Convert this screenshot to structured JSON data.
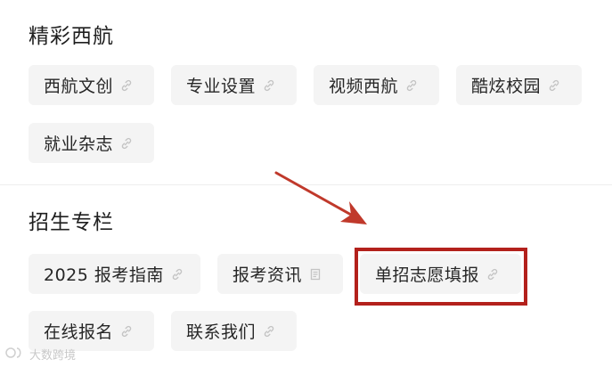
{
  "sections": [
    {
      "title": "精彩西航",
      "chips": [
        {
          "label": "西航文创",
          "icon": "link-icon"
        },
        {
          "label": "专业设置",
          "icon": "link-icon"
        },
        {
          "label": "视频西航",
          "icon": "link-icon"
        },
        {
          "label": "酷炫校园",
          "icon": "link-icon"
        },
        {
          "label": "就业杂志",
          "icon": "link-icon"
        }
      ]
    },
    {
      "title": "招生专栏",
      "chips": [
        {
          "label": "2025 报考指南",
          "icon": "link-icon"
        },
        {
          "label": "报考资讯",
          "icon": "document-icon"
        },
        {
          "label": "单招志愿填报",
          "icon": "link-icon"
        },
        {
          "label": "在线报名",
          "icon": "link-icon"
        },
        {
          "label": "联系我们",
          "icon": "link-icon"
        }
      ]
    }
  ],
  "annotation": {
    "arrow_color": "#c0392b",
    "box_color": "#b3211c",
    "highlighted_chip": "单招志愿填报"
  },
  "watermark": {
    "text": "大数跨境",
    "icon": "brand-logo-icon"
  }
}
